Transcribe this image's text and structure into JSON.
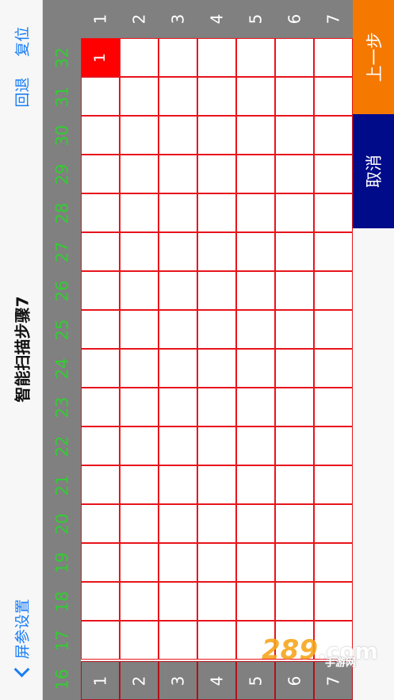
{
  "nav": {
    "back_label": "屏参设置",
    "title": "智能扫描步骤7",
    "undo_label": "回退",
    "reset_label": "复位"
  },
  "columns": [
    "1",
    "2",
    "3",
    "4",
    "5",
    "6",
    "7"
  ],
  "rows": [
    "32",
    "31",
    "30",
    "29",
    "28",
    "27",
    "26",
    "25",
    "24",
    "23",
    "22",
    "21",
    "20",
    "19",
    "18",
    "17"
  ],
  "bottom_row": {
    "label": "16",
    "cells": [
      "1",
      "2",
      "3",
      "4",
      "5",
      "6",
      "7"
    ]
  },
  "grid": {
    "active_cell": {
      "row": "32",
      "column": "1",
      "value": "1"
    }
  },
  "buttons": {
    "prev_label": "上一步",
    "cancel_label": "取消"
  },
  "watermark": {
    "brand": "289",
    "domain": ".com",
    "sub": "手游网"
  },
  "colors": {
    "grid_line": "#e8141c",
    "active_cell": "#ff0000",
    "header_bg": "#808080",
    "row_number": "#33cc33",
    "prev_button": "#f57800",
    "cancel_button": "#000b8a",
    "link": "#1a7ef5"
  },
  "icons": {
    "back": "chevron-left-icon"
  }
}
